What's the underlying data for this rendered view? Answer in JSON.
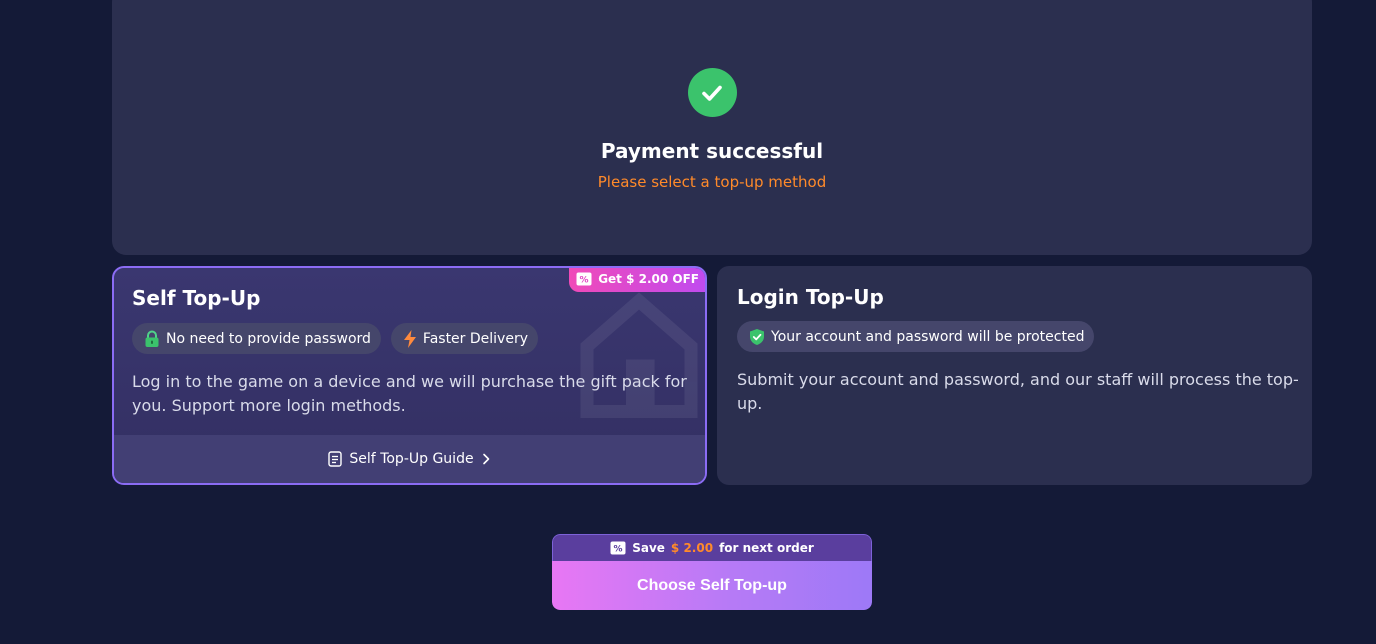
{
  "status": {
    "title": "Payment successful",
    "subtitle": "Please select a top-up method",
    "icon": "check-circle-icon",
    "icon_color": "#3bc36c",
    "subtitle_color": "#ff8a2a"
  },
  "self_topup": {
    "title": "Self Top-Up",
    "promo_badge": "Get $ 2.00 OFF",
    "tags": [
      {
        "icon": "lock-icon",
        "label": "No need to provide password"
      },
      {
        "icon": "lightning-icon",
        "label": "Faster Delivery"
      }
    ],
    "description": "Log in to the game on a device and we will purchase the gift pack for you. Support more login methods.",
    "guide_label": "Self Top-Up Guide",
    "selected": true
  },
  "login_topup": {
    "title": "Login Top-Up",
    "tags": [
      {
        "icon": "shield-check-icon",
        "label": "Your account and password will be protected"
      }
    ],
    "description": "Submit your account and password, and our staff will process the top-up.",
    "selected": false
  },
  "cta": {
    "save_prefix": "Save",
    "save_amount": "$ 2.00",
    "save_suffix": "for next order",
    "button_label": "Choose Self Top-up"
  },
  "colors": {
    "background": "#141a37",
    "card": "#2b2f4f",
    "accent_purple": "#8b6cf4",
    "accent_orange": "#ff8a2a",
    "success_green": "#3bc36c"
  }
}
